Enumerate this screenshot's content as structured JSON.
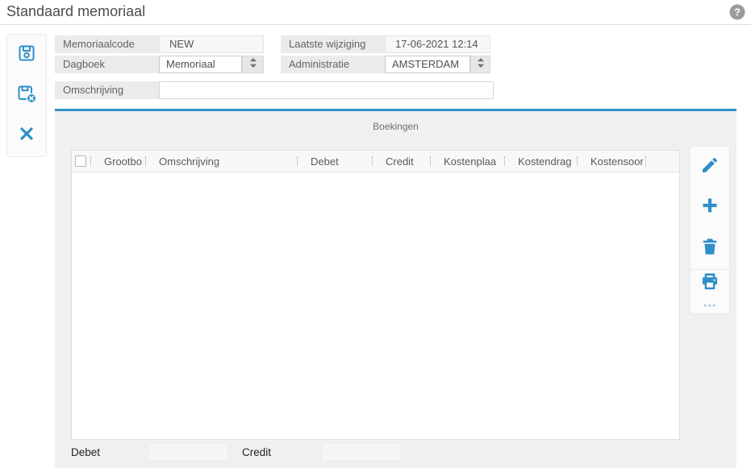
{
  "header": {
    "title": "Standaard memoriaal",
    "help_icon": "help-circle-icon"
  },
  "left_toolbar": {
    "items": [
      {
        "icon": "save-icon"
      },
      {
        "icon": "save-discard-icon"
      },
      {
        "icon": "close-icon"
      }
    ]
  },
  "form": {
    "memoriaalcode": {
      "label": "Memoriaalcode",
      "value": "NEW"
    },
    "dagboek": {
      "label": "Dagboek",
      "value": "Memoriaal"
    },
    "laatste_wijziging": {
      "label": "Laatste wijziging",
      "value": "17-06-2021 12:14"
    },
    "administratie": {
      "label": "Administratie",
      "value": "AMSTERDAM"
    },
    "omschrijving": {
      "label": "Omschrijving",
      "value": "",
      "placeholder": ""
    }
  },
  "boekingen": {
    "title": "Boekingen",
    "columns": [
      "Grootbo",
      "Omschrijving",
      "Debet",
      "Credit",
      "Kostenplaa",
      "Kostendrag",
      "Kostensoor"
    ],
    "rows": [],
    "totals": {
      "debet_label": "Debet",
      "debet_value": "",
      "credit_label": "Credit",
      "credit_value": ""
    }
  },
  "right_toolbar": {
    "items": [
      {
        "icon": "edit-icon"
      },
      {
        "icon": "add-icon"
      },
      {
        "icon": "delete-icon"
      },
      {
        "icon": "print-icon",
        "more_dots": "..."
      }
    ]
  },
  "colors": {
    "accent_blue": "#2e8fc8",
    "panel_grey": "#f0f0f0",
    "label_grey": "#ebebeb",
    "help_grey": "#9c9c9c"
  }
}
